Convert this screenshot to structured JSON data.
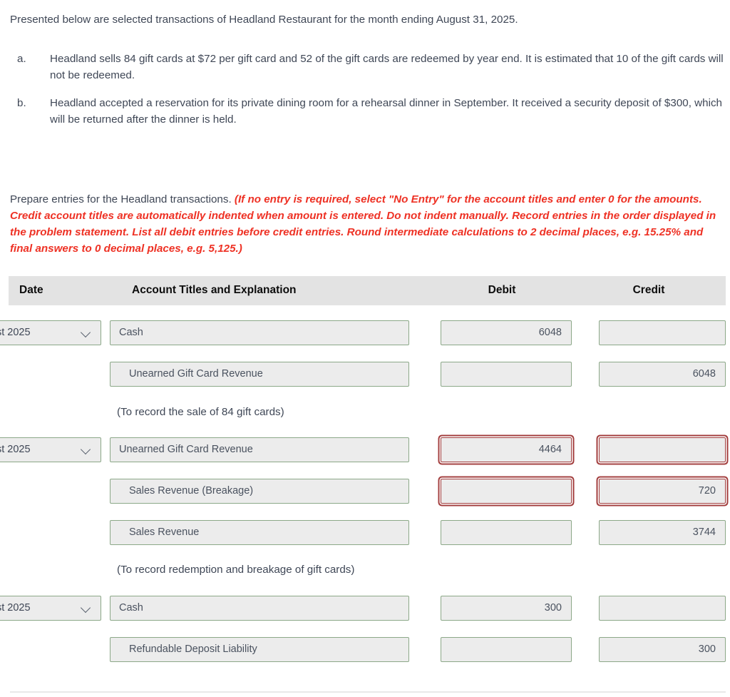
{
  "intro": "Presented below are selected transactions of Headland Restaurant for the month ending August 31, 2025.",
  "problems": [
    {
      "marker": "a.",
      "text": "Headland sells 84 gift cards at $72 per gift card and 52 of the gift cards are redeemed by year end. It is estimated that 10 of the gift cards will not be redeemed."
    },
    {
      "marker": "b.",
      "text": "Headland accepted a reservation for its private dining room for a rehearsal dinner in September. It received a security deposit of $300, which will be returned after the dinner is held."
    }
  ],
  "instructions": {
    "lead": "Prepare entries for the Headland transactions. ",
    "required": "(If no entry is required, select \"No Entry\" for the account titles and enter 0 for the amounts. Credit account titles are automatically indented when amount is entered. Do not indent manually. Record entries in the order displayed in the problem statement. List all debit entries before credit entries. Round intermediate calculations to 2 decimal places, e.g. 15.25% and final answers to 0 decimal places, e.g. 5,125.)",
    "accent_color": "#ee3124"
  },
  "table": {
    "headers": {
      "date": "Date",
      "account": "Account Titles and Explanation",
      "debit": "Debit",
      "credit": "Credit"
    },
    "header_bg": "#e3e3e3",
    "field_bg": "#ececec",
    "field_border": "#8ca888",
    "error_border": "#a33f3f",
    "date_placeholder": "Select a date",
    "entries": [
      {
        "date": "st 2025",
        "date_icon": "chevron-down-icon",
        "lines": [
          {
            "account": "Cash",
            "indent": false,
            "debit": "6048",
            "credit": "",
            "debit_error": false,
            "credit_error": false
          },
          {
            "account": "Unearned Gift Card Revenue",
            "indent": true,
            "debit": "",
            "credit": "6048",
            "debit_error": false,
            "credit_error": false
          }
        ],
        "explanation": "(To record the sale of 84 gift cards)"
      },
      {
        "date": "st 2025",
        "date_icon": "chevron-down-icon",
        "lines": [
          {
            "account": "Unearned Gift Card Revenue",
            "indent": false,
            "debit": "4464",
            "credit": "",
            "debit_error": true,
            "credit_error": true
          },
          {
            "account": "Sales Revenue (Breakage)",
            "indent": true,
            "debit": "",
            "credit": "720",
            "debit_error": true,
            "credit_error": true
          },
          {
            "account": "Sales Revenue",
            "indent": true,
            "debit": "",
            "credit": "3744",
            "debit_error": false,
            "credit_error": false
          }
        ],
        "explanation": "(To record redemption and breakage of gift cards)"
      },
      {
        "date": "st 2025",
        "date_icon": "chevron-down-icon",
        "lines": [
          {
            "account": "Cash",
            "indent": false,
            "debit": "300",
            "credit": "",
            "debit_error": false,
            "credit_error": false
          },
          {
            "account": "Refundable Deposit Liability",
            "indent": true,
            "debit": "",
            "credit": "300",
            "debit_error": false,
            "credit_error": false
          }
        ],
        "explanation": ""
      }
    ]
  }
}
